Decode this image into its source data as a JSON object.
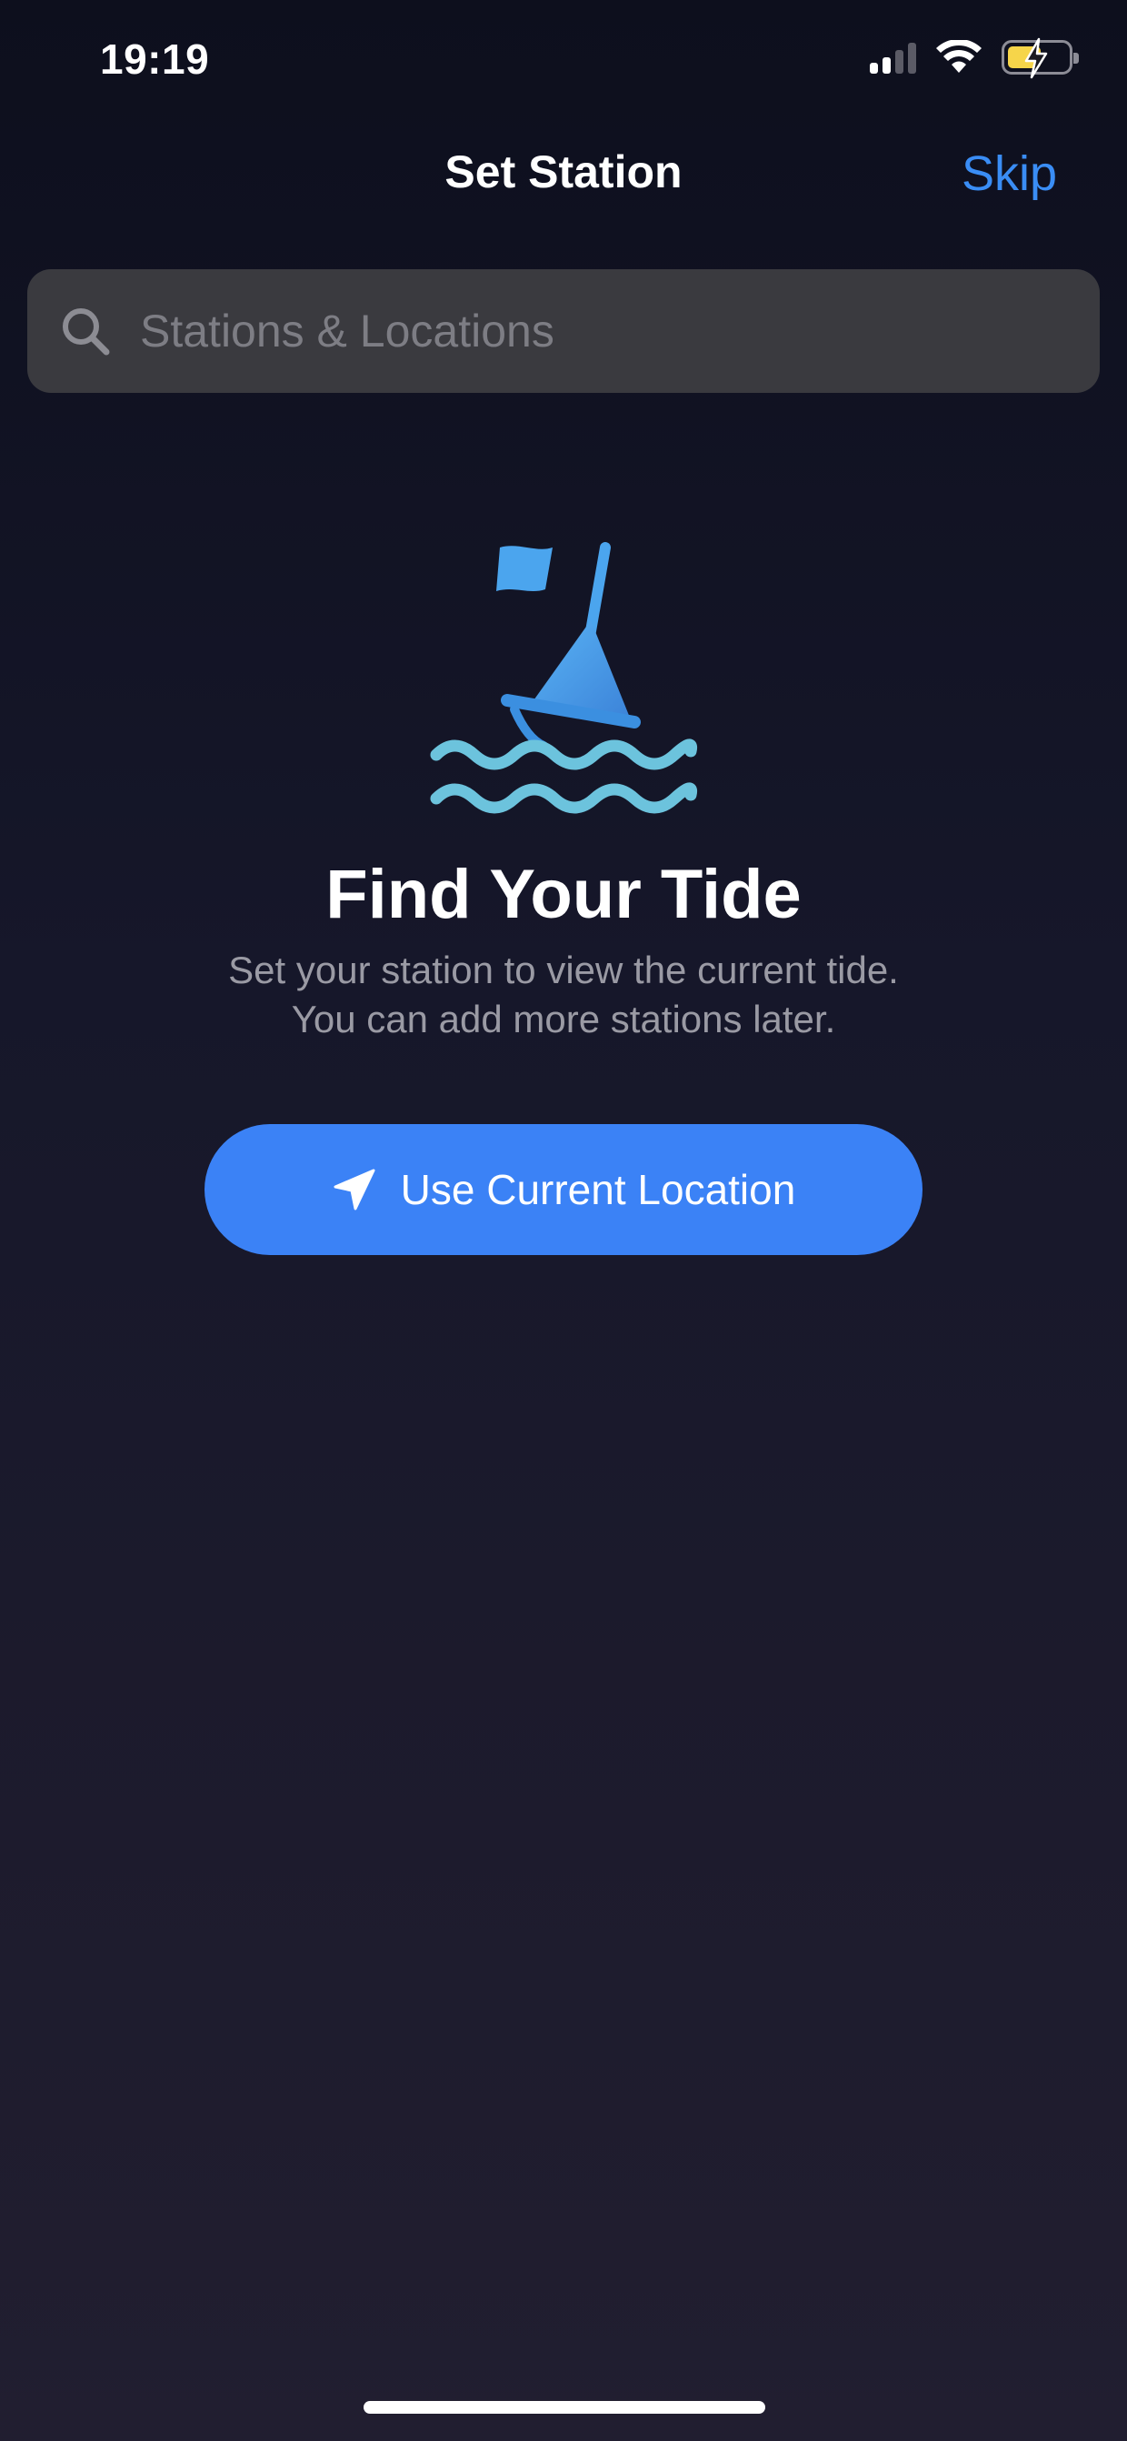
{
  "status_bar": {
    "time": "19:19",
    "icons": [
      "cellular-signal-icon",
      "wifi-icon",
      "battery-charging-icon"
    ],
    "battery_color": "#f6d54a"
  },
  "nav": {
    "title": "Set Station",
    "skip_label": "Skip",
    "accent_color": "#3a8df5"
  },
  "search": {
    "placeholder": "Stations & Locations",
    "value": "",
    "icon": "search-icon"
  },
  "hero": {
    "icon": "buoy-flag-waves-icon",
    "title": "Find Your Tide",
    "subtitle_line1": "Set your station to view the current tide.",
    "subtitle_line2": "You can add more stations later."
  },
  "cta": {
    "label": "Use Current Location",
    "icon": "location-arrow-icon",
    "color": "#3b82f6"
  }
}
